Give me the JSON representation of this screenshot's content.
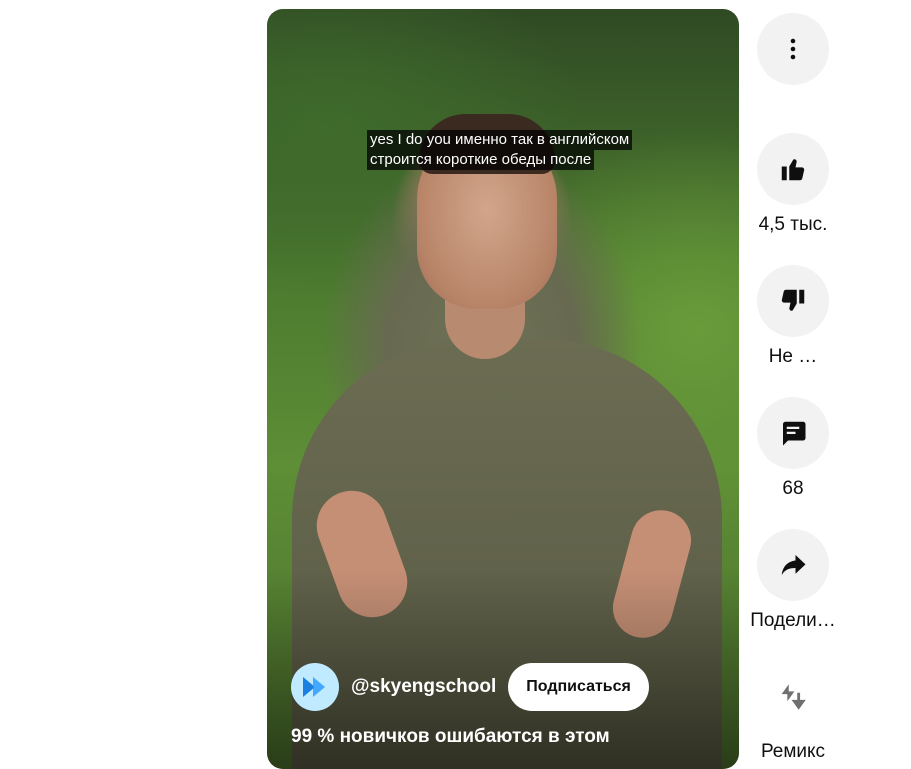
{
  "video": {
    "captions": [
      "yes I do you именно так в английском",
      "строится короткие обеды после"
    ],
    "channel_handle": "@skyengschool",
    "subscribe_label": "Подписаться",
    "title": "99 % новичков ошибаются в этом"
  },
  "actions": {
    "more_icon": "more-vertical-icon",
    "like": {
      "icon": "thumb-up-icon",
      "label": "4,5 тыс."
    },
    "dislike": {
      "icon": "thumb-down-icon",
      "label": "Не …"
    },
    "comments": {
      "icon": "comment-icon",
      "label": "68"
    },
    "share": {
      "icon": "share-icon",
      "label": "Подели…"
    },
    "remix": {
      "icon": "remix-icon",
      "label": "Ремикс"
    }
  },
  "colors": {
    "button_bg": "#f2f2f2",
    "text": "#0f0f0f",
    "avatar_bg": "#bfeaff",
    "avatar_logo": "#1a7fe0"
  }
}
